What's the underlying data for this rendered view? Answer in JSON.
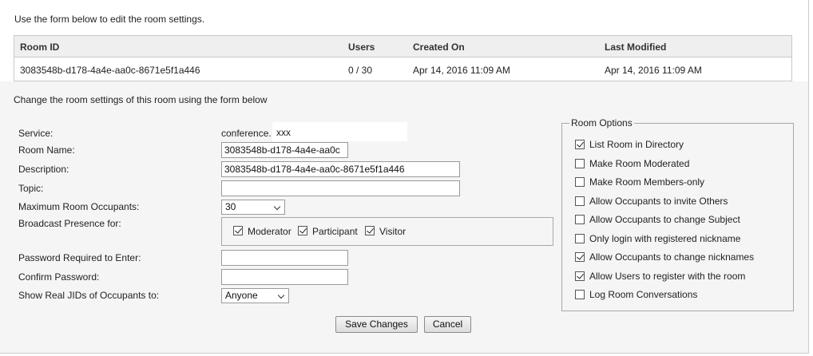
{
  "intro_text": "Use the form below to edit the room settings.",
  "table": {
    "headers": {
      "room_id": "Room ID",
      "users": "Users",
      "created_on": "Created On",
      "last_modified": "Last Modified"
    },
    "row": {
      "room_id": "3083548b-d178-4a4e-aa0c-8671e5f1a446",
      "users": "0 / 30",
      "created_on": "Apr 14, 2016 11:09 AM",
      "last_modified": "Apr 14, 2016 11:09 AM"
    }
  },
  "form": {
    "subtitle": "Change the room settings of this room using the form below",
    "service_label": "Service:",
    "service_prefix": "conference.",
    "service_value": "xxx",
    "room_name_label": "Room Name:",
    "room_name_value": "3083548b-d178-4a4e-aa0c",
    "description_label": "Description:",
    "description_value": "3083548b-d178-4a4e-aa0c-8671e5f1a446",
    "topic_label": "Topic:",
    "topic_value": "",
    "max_occupants_label": "Maximum Room Occupants:",
    "max_occupants_value": "30",
    "broadcast_label": "Broadcast Presence for:",
    "broadcast": {
      "moderator": {
        "label": "Moderator",
        "checked": true
      },
      "participant": {
        "label": "Participant",
        "checked": true
      },
      "visitor": {
        "label": "Visitor",
        "checked": true
      }
    },
    "password_label": "Password Required to Enter:",
    "confirm_password_label": "Confirm Password:",
    "show_jids_label": "Show Real JIDs of Occupants to:",
    "show_jids_value": "Anyone"
  },
  "room_options": {
    "legend": "Room Options",
    "items": [
      {
        "label": "List Room in Directory",
        "checked": true
      },
      {
        "label": "Make Room Moderated",
        "checked": false
      },
      {
        "label": "Make Room Members-only",
        "checked": false
      },
      {
        "label": "Allow Occupants to invite Others",
        "checked": false
      },
      {
        "label": "Allow Occupants to change Subject",
        "checked": false
      },
      {
        "label": "Only login with registered nickname",
        "checked": false
      },
      {
        "label": "Allow Occupants to change nicknames",
        "checked": true
      },
      {
        "label": "Allow Users to register with the room",
        "checked": true
      },
      {
        "label": "Log Room Conversations",
        "checked": false
      }
    ]
  },
  "buttons": {
    "save": "Save Changes",
    "cancel": "Cancel"
  }
}
